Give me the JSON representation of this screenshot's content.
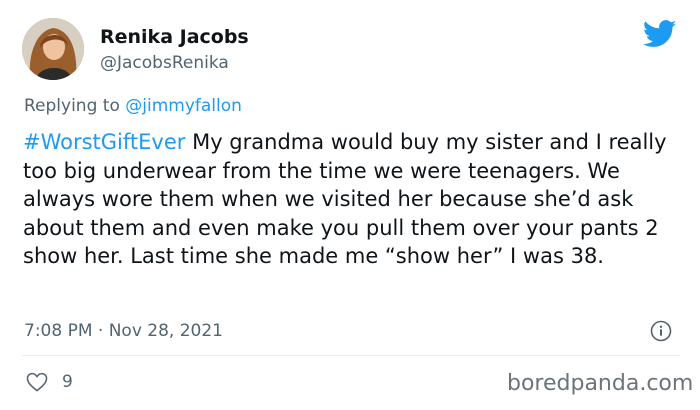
{
  "user": {
    "display_name": "Renika Jacobs",
    "handle": "@JacobsRenika"
  },
  "reply": {
    "prefix": "Replying to ",
    "mention": "@jimmyfallon"
  },
  "tweet": {
    "hashtag": "#WorstGiftEver",
    "text": "  My grandma would buy my sister and I really too big underwear from the time we were teenagers. We always wore them when we visited her because she’d ask about them and even make you pull them over your pants 2 show her. Last time she made me “show her” I was 38."
  },
  "meta": {
    "timestamp": "7:08 PM · Nov 28, 2021"
  },
  "actions": {
    "like_count": "9"
  },
  "watermark": "boredpanda.com",
  "colors": {
    "link": "#1d9bf0",
    "secondary_text": "#536471",
    "twitter_bird": "#1d9bf0"
  },
  "icons": [
    "twitter-bird-icon",
    "info-icon",
    "heart-icon"
  ]
}
